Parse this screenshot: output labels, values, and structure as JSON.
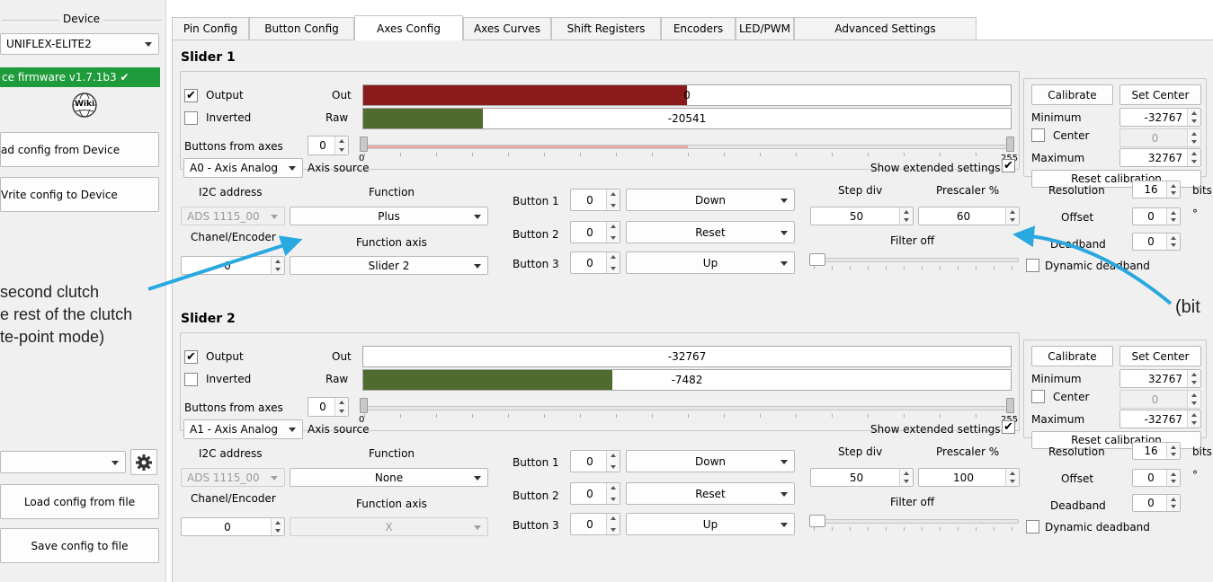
{
  "sidebar": {
    "device_label": "Device",
    "device_value": "UNIFLEX-ELITE2",
    "firmware_status": "ce firmware v1.7.1b3 ✔",
    "wiki_icon_text": "Wiki",
    "read_button": "ad config from Device",
    "write_button": "Vrite config to Device",
    "profile_value": "",
    "load_file_button": "Load config from file",
    "save_file_button": "Save config to file"
  },
  "tabs": [
    "Pin Config",
    "Button Config",
    "Axes Config",
    "Axes Curves",
    "Shift Registers",
    "Encoders",
    "LED/PWM",
    "Advanced Settings"
  ],
  "active_tab": "Axes Config",
  "labels": {
    "output": "Output",
    "inverted": "Inverted",
    "out": "Out",
    "raw": "Raw",
    "buttons_from_axes": "Buttons from axes",
    "axis_source": "Axis source",
    "show_extended": "Show extended settings",
    "calibrate": "Calibrate",
    "set_center": "Set Center",
    "minimum": "Minimum",
    "center": "Center",
    "maximum": "Maximum",
    "reset_calibration": "Reset calibration",
    "i2c_address": "I2C address",
    "function": "Function",
    "chanel_encoder": "Chanel/Encoder",
    "function_axis": "Function axis",
    "button1": "Button 1",
    "button2": "Button 2",
    "button3": "Button 3",
    "step_div": "Step div",
    "prescaler": "Prescaler %",
    "filter": "Filter off",
    "resolution": "Resolution",
    "bits": "bits",
    "offset": "Offset",
    "degree": "°",
    "deadband": "Deadband",
    "dynamic_deadband": "Dynamic deadband",
    "tick_min": "0",
    "tick_max": "255"
  },
  "sliders": [
    {
      "title": "Slider 1",
      "output_checked": true,
      "inverted_checked": false,
      "out_text": "0",
      "out_fill": 0.5,
      "out_color": "#8b1a1a",
      "raw_text": "-20541",
      "raw_fill": 0.185,
      "raw_color": "#4f6b2e",
      "buttons_from_axes": "0",
      "axis_source": "A0 - Axis Analog",
      "show_extended_checked": true,
      "minimum": "-32767",
      "center_checked": false,
      "center_value": "0",
      "maximum": "32767",
      "i2c_address": "ADS 1115_00",
      "function": "Plus",
      "channel": "0",
      "function_axis": "Slider 2",
      "function_axis_enabled": true,
      "button1": "0",
      "button1_action": "Down",
      "button2": "0",
      "button2_action": "Reset",
      "button3": "0",
      "button3_action": "Up",
      "step_div": "50",
      "prescaler": "60",
      "resolution": "16",
      "offset": "0",
      "deadband": "0",
      "dynamic_deadband_checked": false,
      "bfa_range_fill": 0.5
    },
    {
      "title": "Slider 2",
      "output_checked": true,
      "inverted_checked": false,
      "out_text": "-32767",
      "out_fill": 0,
      "out_color": "#8b1a1a",
      "raw_text": "-7482",
      "raw_fill": 0.385,
      "raw_color": "#4f6b2e",
      "buttons_from_axes": "0",
      "axis_source": "A1 - Axis Analog",
      "show_extended_checked": true,
      "minimum": "32767",
      "center_checked": false,
      "center_value": "0",
      "maximum": "-32767",
      "i2c_address": "ADS 1115_00",
      "function": "None",
      "channel": "0",
      "function_axis": "X",
      "function_axis_enabled": false,
      "button1": "0",
      "button1_action": "Down",
      "button2": "0",
      "button2_action": "Reset",
      "button3": "0",
      "button3_action": "Up",
      "step_div": "50",
      "prescaler": "100",
      "resolution": "16",
      "offset": "0",
      "deadband": "0",
      "dynamic_deadband_checked": false,
      "bfa_range_fill": 0
    }
  ],
  "annotation": {
    "left_line1": "second clutch",
    "left_line2": "e rest of the clutch",
    "left_line3": "te-point mode)",
    "right_text": "(bit",
    "arrow_color": "#29a8e0"
  }
}
